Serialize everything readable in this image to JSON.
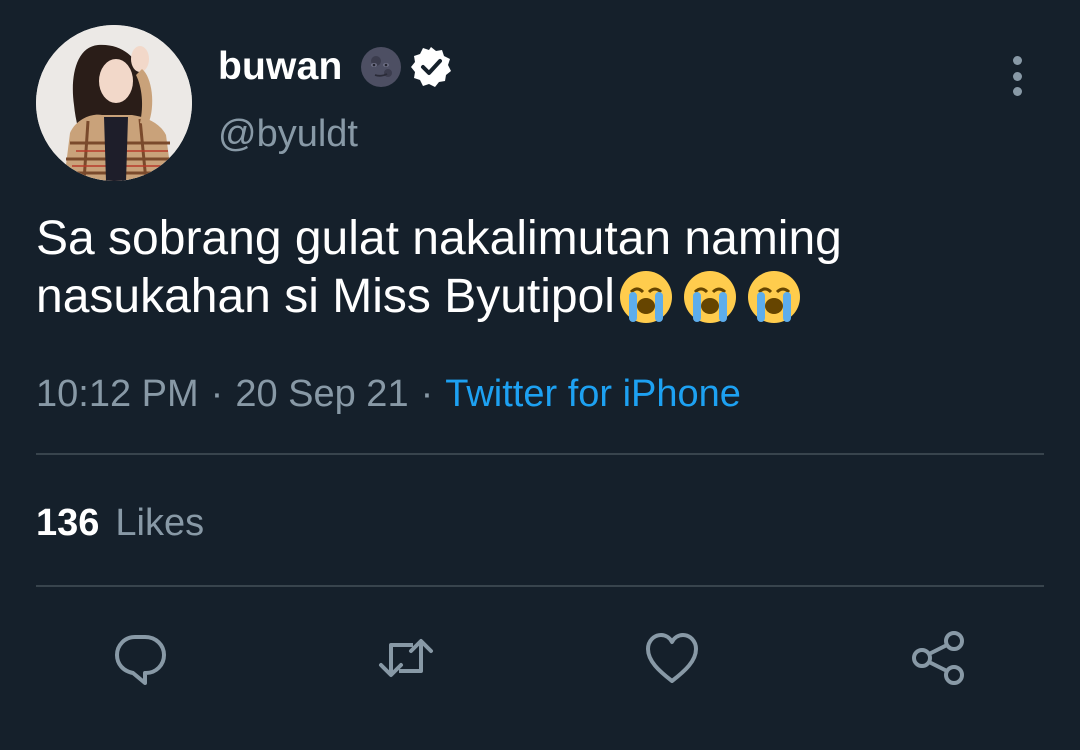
{
  "tweet": {
    "display_name": "buwan",
    "handle": "@byuldt",
    "text_line1": "Sa sobrang gulat nakalimutan naming",
    "text_line2": "nasukahan si Miss Byutipol",
    "emojis": [
      "loudly-crying-face-emoji",
      "loudly-crying-face-emoji",
      "loudly-crying-face-emoji"
    ],
    "time": "10:12 PM",
    "date": "20 Sep 21",
    "source": "Twitter for iPhone",
    "likes_count": "136",
    "likes_label": "Likes"
  },
  "icons": {
    "name_emoji": "new-moon-face-icon",
    "verified": "verified-badge-icon",
    "more": "more-vertical-icon",
    "actions": [
      "reply-icon",
      "retweet-icon",
      "like-icon",
      "share-icon"
    ]
  },
  "colors": {
    "background": "#15202b",
    "text_primary": "#ffffff",
    "text_secondary": "#8899a6",
    "accent": "#1da1f2",
    "divider": "#38444d"
  }
}
